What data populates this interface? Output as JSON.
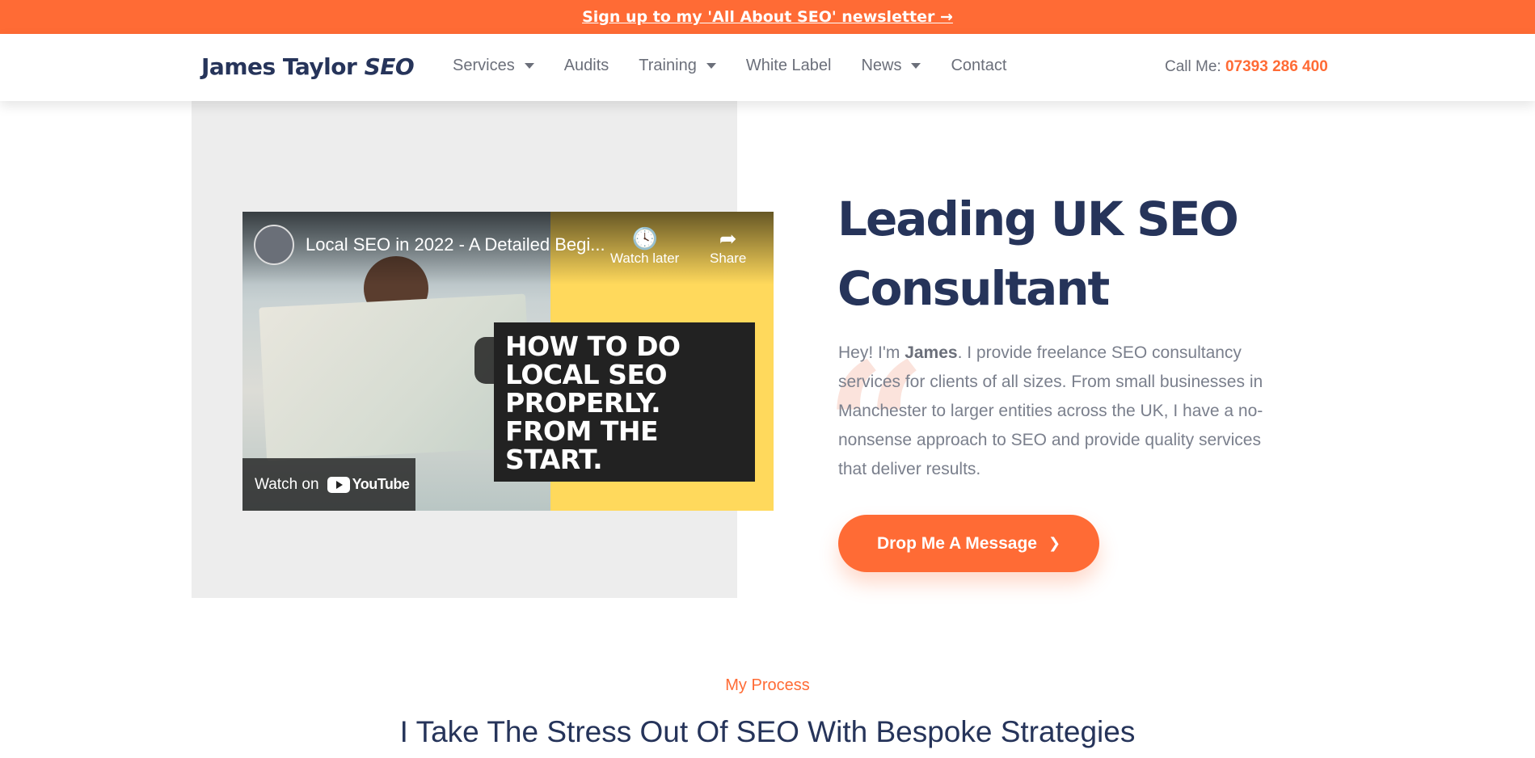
{
  "topbar": {
    "link_text": "Sign up to my 'All About SEO' newsletter →"
  },
  "header": {
    "logo_main": "James Taylor",
    "logo_italic": "SEO",
    "nav": [
      {
        "label": "Services",
        "dropdown": true
      },
      {
        "label": "Audits",
        "dropdown": false
      },
      {
        "label": "Training",
        "dropdown": true
      },
      {
        "label": "White Label",
        "dropdown": false
      },
      {
        "label": "News",
        "dropdown": true
      },
      {
        "label": "Contact",
        "dropdown": false
      }
    ],
    "call_label": "Call Me:",
    "phone": "07393 286 400"
  },
  "video": {
    "title": "Local SEO in 2022 - A Detailed Begi...",
    "watch_later": "Watch later",
    "share": "Share",
    "overlay_lines": [
      "HOW TO DO",
      "LOCAL SEO",
      "PROPERLY.",
      "FROM THE",
      "START."
    ],
    "watch_on": "Watch on",
    "youtube": "YouTube"
  },
  "hero": {
    "title_line1": "Leading UK SEO",
    "title_line2": "Consultant",
    "text_before": "Hey! I'm ",
    "text_name": "James",
    "text_after": ". I provide freelance SEO consultancy services for clients of all sizes. From small businesses in Manchester to larger entities across the UK, I have a no-nonsense approach to SEO and provide quality services that deliver results.",
    "cta": "Drop Me A Message"
  },
  "process": {
    "label": "My Process",
    "title": "I Take The Stress Out Of SEO With Bespoke Strategies"
  },
  "colors": {
    "accent": "#ff6b35",
    "navy": "#26345a",
    "muted": "#6b6f7a"
  }
}
